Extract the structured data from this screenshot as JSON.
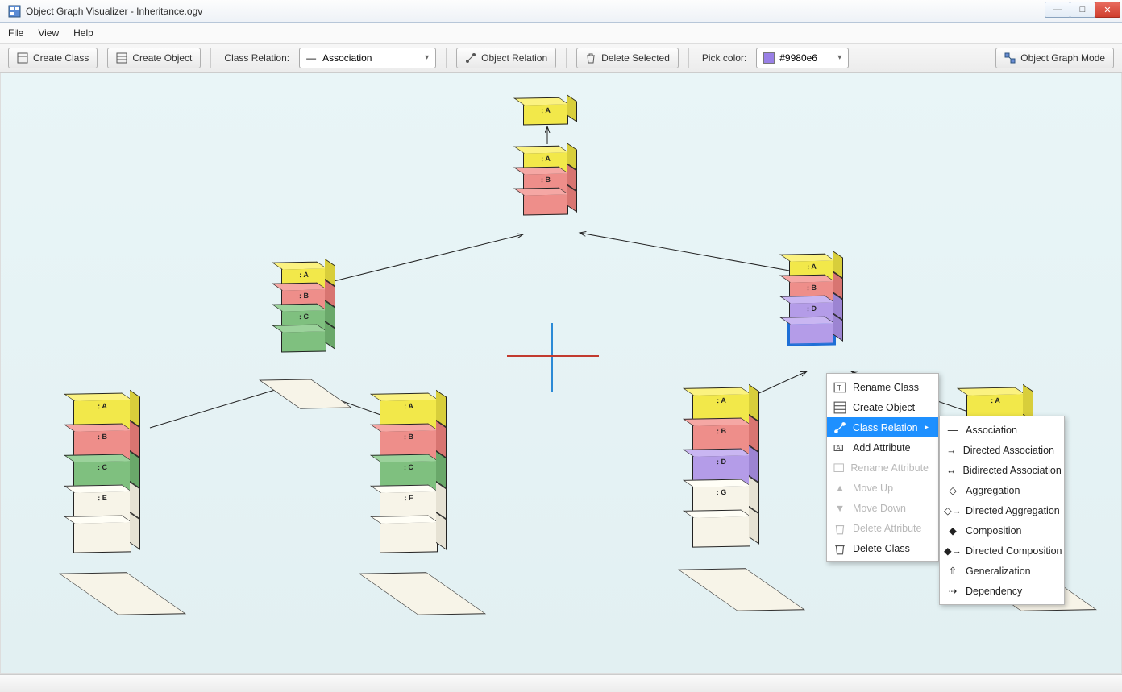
{
  "window": {
    "title": "Object Graph Visualizer - Inheritance.ogv"
  },
  "menu": {
    "file": "File",
    "view": "View",
    "help": "Help"
  },
  "toolbar": {
    "create_class": "Create Class",
    "create_object": "Create Object",
    "class_relation_label": "Class Relation:",
    "class_relation_value": "Association",
    "object_relation": "Object Relation",
    "delete_selected": "Delete Selected",
    "pick_color_label": "Pick color:",
    "color_value": "#9980e6",
    "object_graph_mode": "Object Graph Mode"
  },
  "nodes": {
    "top_single": ": A",
    "top_stack": {
      "a": ": A",
      "b": ": B"
    },
    "left_mid": {
      "a": ": A",
      "b": ": B",
      "c": ": C"
    },
    "far_left": {
      "a": ": A",
      "b": ": B",
      "c": ": C",
      "e": ": E"
    },
    "center_bottom": {
      "a": ": A",
      "b": ": B",
      "c": ": C",
      "f": ": F"
    },
    "right_mid": {
      "a": ": A",
      "b": ": B",
      "d": ": D"
    },
    "center_right": {
      "a": ": A",
      "b": ": B",
      "d": ": D",
      "g": ": G"
    },
    "far_right": {
      "a": ": A"
    }
  },
  "context_menu": {
    "rename_class": "Rename Class",
    "create_object": "Create Object",
    "class_relation": "Class Relation",
    "add_attribute": "Add Attribute",
    "rename_attribute": "Rename Attribute",
    "move_up": "Move Up",
    "move_down": "Move Down",
    "delete_attribute": "Delete Attribute",
    "delete_class": "Delete Class"
  },
  "relation_submenu": {
    "association": "Association",
    "directed_association": "Directed Association",
    "bidirected_association": "Bidirected Association",
    "aggregation": "Aggregation",
    "directed_aggregation": "Directed Aggregation",
    "composition": "Composition",
    "directed_composition": "Directed Composition",
    "generalization": "Generalization",
    "dependency": "Dependency"
  }
}
